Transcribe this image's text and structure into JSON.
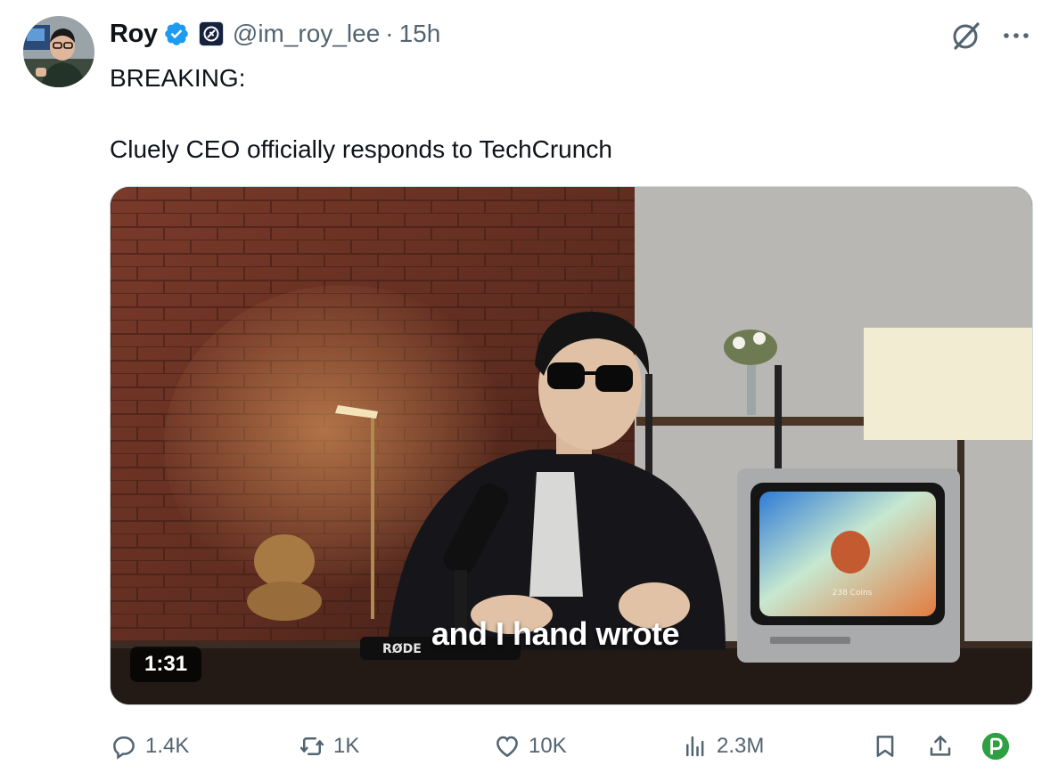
{
  "tweet": {
    "author_name": "Roy",
    "handle": "@im_roy_lee",
    "separator": "·",
    "time": "15h",
    "lines": [
      "BREAKING:",
      "Cluely CEO officially responds to TechCrunch"
    ]
  },
  "video": {
    "caption": "and I hand wrote",
    "duration": "1:31",
    "mic_brand": "RØDE",
    "tv_text": "238 Coins"
  },
  "actions": {
    "replies": "1.4K",
    "reposts": "1K",
    "likes": "10K",
    "views": "2.3M"
  },
  "icons": {
    "verified": "verified-badge-icon",
    "affiliate": "affiliate-badge-icon",
    "grok": "grok-icon",
    "more": "more-icon",
    "reply": "reply-icon",
    "repost": "repost-icon",
    "like": "heart-icon",
    "views": "views-icon",
    "bookmark": "bookmark-icon",
    "share": "share-icon",
    "extension": "extension-icon"
  },
  "colors": {
    "text": "#0f1419",
    "secondary": "#536471",
    "verified_blue": "#1d9bf0",
    "extension_green": "#2ea043"
  }
}
